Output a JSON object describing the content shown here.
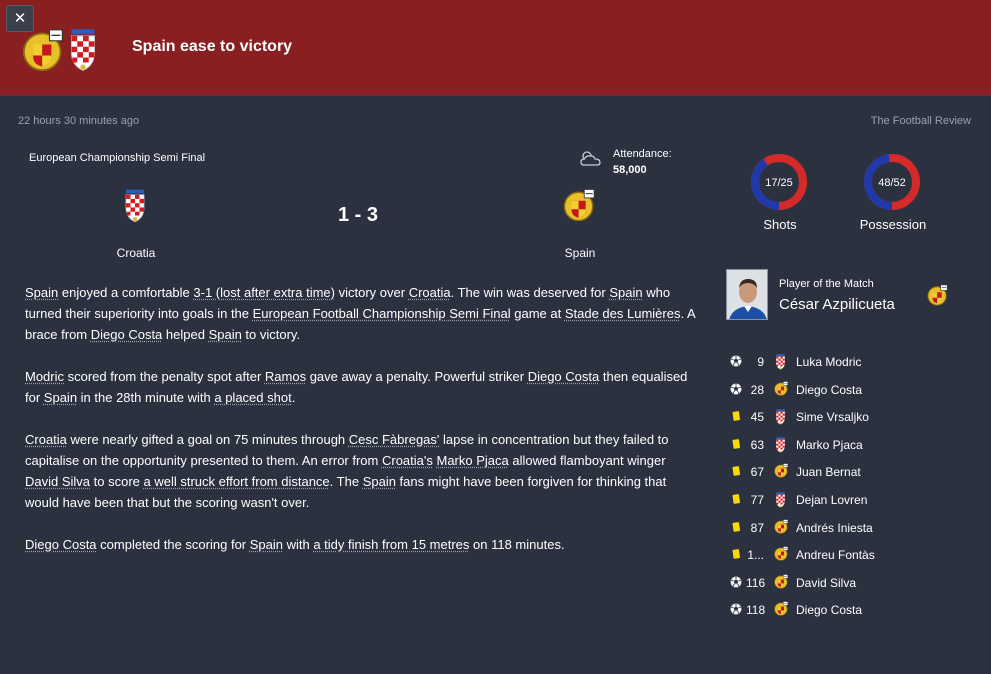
{
  "header": {
    "close_label": "✕",
    "title": "Spain ease to victory"
  },
  "meta": {
    "time_ago": "22 hours 30 minutes ago",
    "source": "The Football Review"
  },
  "match": {
    "competition": "European Championship Semi Final",
    "attendance_label": "Attendance:",
    "attendance_value": "58,000",
    "weather_icon": "cloud-icon",
    "home_team": "Croatia",
    "away_team": "Spain",
    "score": "1 - 3"
  },
  "stats": [
    {
      "label": "Shots",
      "value": "17/25",
      "home_share": 0.405
    },
    {
      "label": "Possession",
      "value": "48/52",
      "home_share": 0.48
    }
  ],
  "colors": {
    "header_bg": "#8a1f21",
    "page_bg": "#2c3140",
    "home_ring": "#1f3aa8",
    "away_ring": "#d42a2a",
    "yellow_card": "#f5d90a"
  },
  "potm": {
    "label": "Player of the Match",
    "name": "César Azpilicueta"
  },
  "report": {
    "p1": {
      "a": "Spain",
      "b": " enjoyed a comfortable ",
      "c": "3-1 (lost after extra time)",
      "d": " victory over ",
      "e": "Croatia",
      "f": ". The win was deserved for ",
      "g": "Spain",
      "h": " who turned their superiority into goals in the ",
      "i": "European Football Championship Semi Final",
      "j": " game at ",
      "k": "Stade des Lumières",
      "l": ". A brace from ",
      "m": "Diego Costa",
      "n": " helped ",
      "o": "Spain",
      "p": " to victory."
    },
    "p2": {
      "a": "Modric",
      "b": " scored from the penalty spot after ",
      "c": "Ramos",
      "d": " gave away a penalty. Powerful striker ",
      "e": "Diego Costa",
      "f": " then equalised for ",
      "g": "Spain",
      "h": " in the 28th minute with ",
      "i": "a placed shot",
      "j": "."
    },
    "p3": {
      "a": "Croatia",
      "b": " were nearly gifted a goal on 75 minutes through ",
      "c": "Cesc Fàbregas'",
      "d": " lapse in concentration but they failed to capitalise on the opportunity presented to them. An error from ",
      "e": "Croatia's",
      "f": " ",
      "g": "Marko Pjaca",
      "h": " allowed flamboyant winger ",
      "i": "David Silva",
      "j": " to score ",
      "k": "a well struck effort from distance",
      "l": ". The ",
      "m": "Spain",
      "n": " fans might have been forgiven for thinking that would have been that but the scoring wasn't over."
    },
    "p4": {
      "a": "Diego Costa",
      "b": " completed the scoring for ",
      "c": "Spain",
      "d": " with ",
      "e": "a tidy finish from 15 metres",
      "f": " on 118 minutes."
    }
  },
  "events": [
    {
      "type": "goal",
      "icon": "football-icon",
      "minute": "9",
      "team": "croatia",
      "player": "Luka Modric"
    },
    {
      "type": "goal",
      "icon": "football-icon",
      "minute": "28",
      "team": "spain",
      "player": "Diego Costa"
    },
    {
      "type": "yellow",
      "icon": "yellow-card-icon",
      "minute": "45",
      "team": "croatia",
      "player": "Sime Vrsaljko"
    },
    {
      "type": "yellow",
      "icon": "yellow-card-icon",
      "minute": "63",
      "team": "croatia",
      "player": "Marko Pjaca"
    },
    {
      "type": "yellow",
      "icon": "yellow-card-icon",
      "minute": "67",
      "team": "spain",
      "player": "Juan Bernat"
    },
    {
      "type": "yellow",
      "icon": "yellow-card-icon",
      "minute": "77",
      "team": "croatia",
      "player": "Dejan Lovren"
    },
    {
      "type": "yellow",
      "icon": "yellow-card-icon",
      "minute": "87",
      "team": "spain",
      "player": "Andrés Iniesta"
    },
    {
      "type": "yellow",
      "icon": "yellow-card-icon",
      "minute": "1...",
      "team": "spain",
      "player": "Andreu Fontàs"
    },
    {
      "type": "goal",
      "icon": "football-icon",
      "minute": "116",
      "team": "spain",
      "player": "David Silva"
    },
    {
      "type": "goal",
      "icon": "football-icon",
      "minute": "118",
      "team": "spain",
      "player": "Diego Costa"
    }
  ]
}
